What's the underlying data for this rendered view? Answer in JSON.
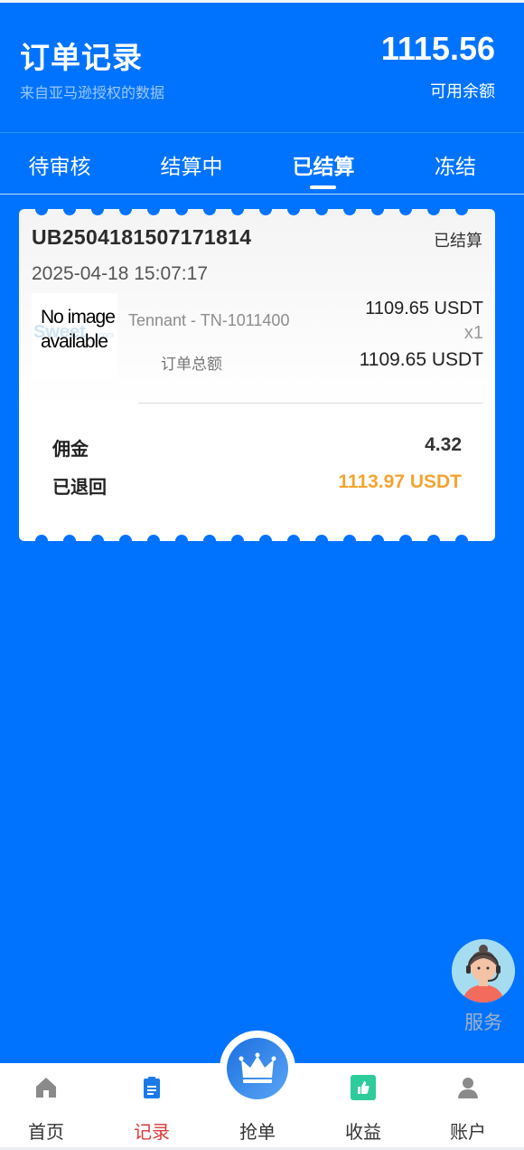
{
  "header": {
    "title": "订单记录",
    "subtitle": "来自亚马逊授权的数据",
    "balance": "1115.56",
    "balance_label": "可用余额"
  },
  "tabs": [
    {
      "label": "待审核",
      "active": false
    },
    {
      "label": "结算中",
      "active": false
    },
    {
      "label": "已结算",
      "active": true
    },
    {
      "label": "冻结",
      "active": false
    }
  ],
  "order": {
    "order_no": "UB2504181507171814",
    "status": "已结算",
    "datetime": "2025-04-18 15:07:17",
    "image": {
      "line1": "No image",
      "line2": "available",
      "watermark": "Sweet",
      "watermark_small": "com"
    },
    "product_name": "Tennant - TN-1011400",
    "price": "1109.65 USDT",
    "quantity": "x1",
    "total_label": "订单总额",
    "total_value": "1109.65 USDT",
    "commission_label": "佣金",
    "commission_value": "4.32",
    "returned_label": "已退回",
    "returned_value": "1113.97 USDT"
  },
  "service": {
    "label": "服务",
    "icon": "customer-service-agent-icon"
  },
  "bottom_nav": {
    "items": [
      {
        "label": "首页",
        "icon": "home-icon",
        "active": false
      },
      {
        "label": "记录",
        "icon": "clipboard-icon",
        "active": true
      },
      {
        "label": "抢单",
        "icon": "crown-icon",
        "active": false
      },
      {
        "label": "收益",
        "icon": "thumbs-up-icon",
        "active": false
      },
      {
        "label": "账户",
        "icon": "user-icon",
        "active": false
      }
    ]
  },
  "colors": {
    "background": "#0073fe",
    "active_nav": "#d83a3a",
    "returned_amount": "#f5a431",
    "earnings_icon": "#2ecc9a"
  }
}
